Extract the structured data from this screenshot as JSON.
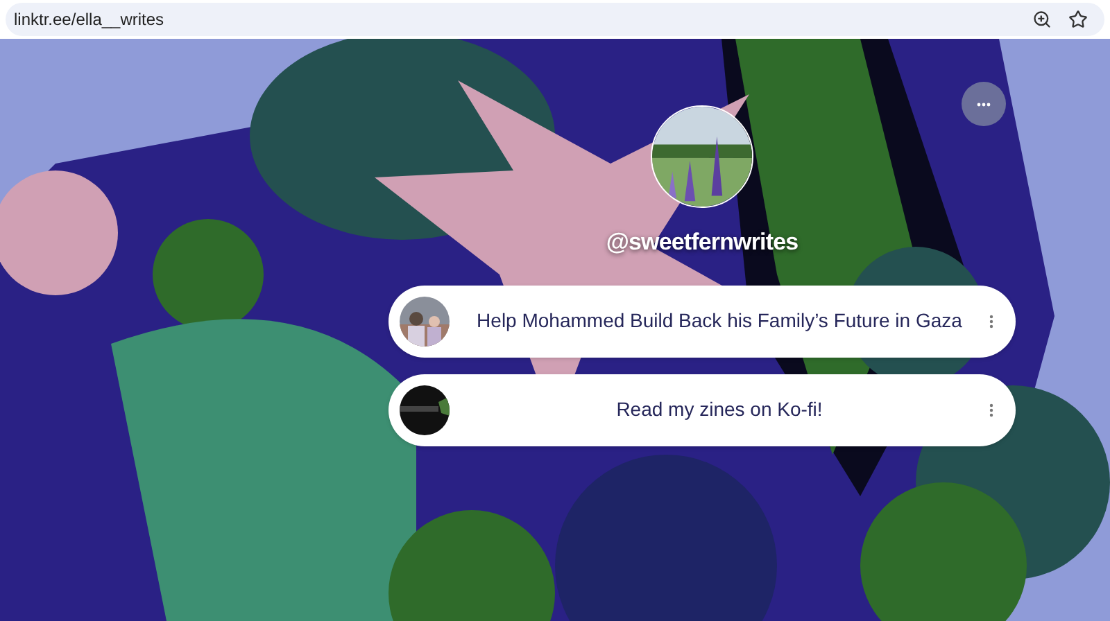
{
  "browser": {
    "url": "linktr.ee/ella__writes"
  },
  "profile": {
    "username": "@sweetfernwrites"
  },
  "links": [
    {
      "title": "Help Mohammed Build Back his Family’s Future in Gaza"
    },
    {
      "title": "Read my zines on Ko-fi!"
    }
  ]
}
